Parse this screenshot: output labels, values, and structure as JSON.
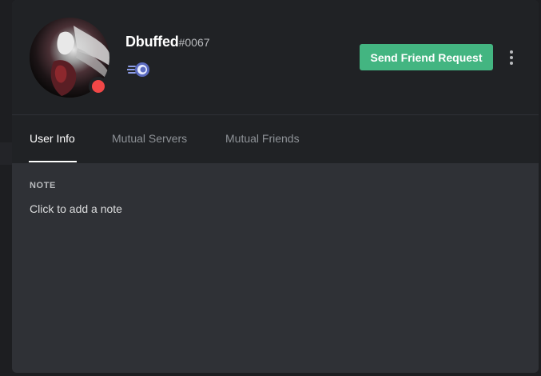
{
  "profile": {
    "username": "Dbuffed",
    "discriminator": "#0067",
    "status": "do-not-disturb",
    "status_color": "#f04747",
    "avatar_icon": "avatar-image",
    "badge_icon": "nitro-badge-icon"
  },
  "actions": {
    "friend_request_label": "Send Friend Request",
    "friend_request_color": "#43b581",
    "more_icon": "more-vertical-icon"
  },
  "tabs": [
    {
      "label": "User Info",
      "active": true
    },
    {
      "label": "Mutual Servers",
      "active": false
    },
    {
      "label": "Mutual Friends",
      "active": false
    }
  ],
  "note": {
    "label": "NOTE",
    "placeholder": "Click to add a note",
    "value": ""
  },
  "colors": {
    "header_bg": "#202225",
    "body_bg": "#2f3136"
  }
}
